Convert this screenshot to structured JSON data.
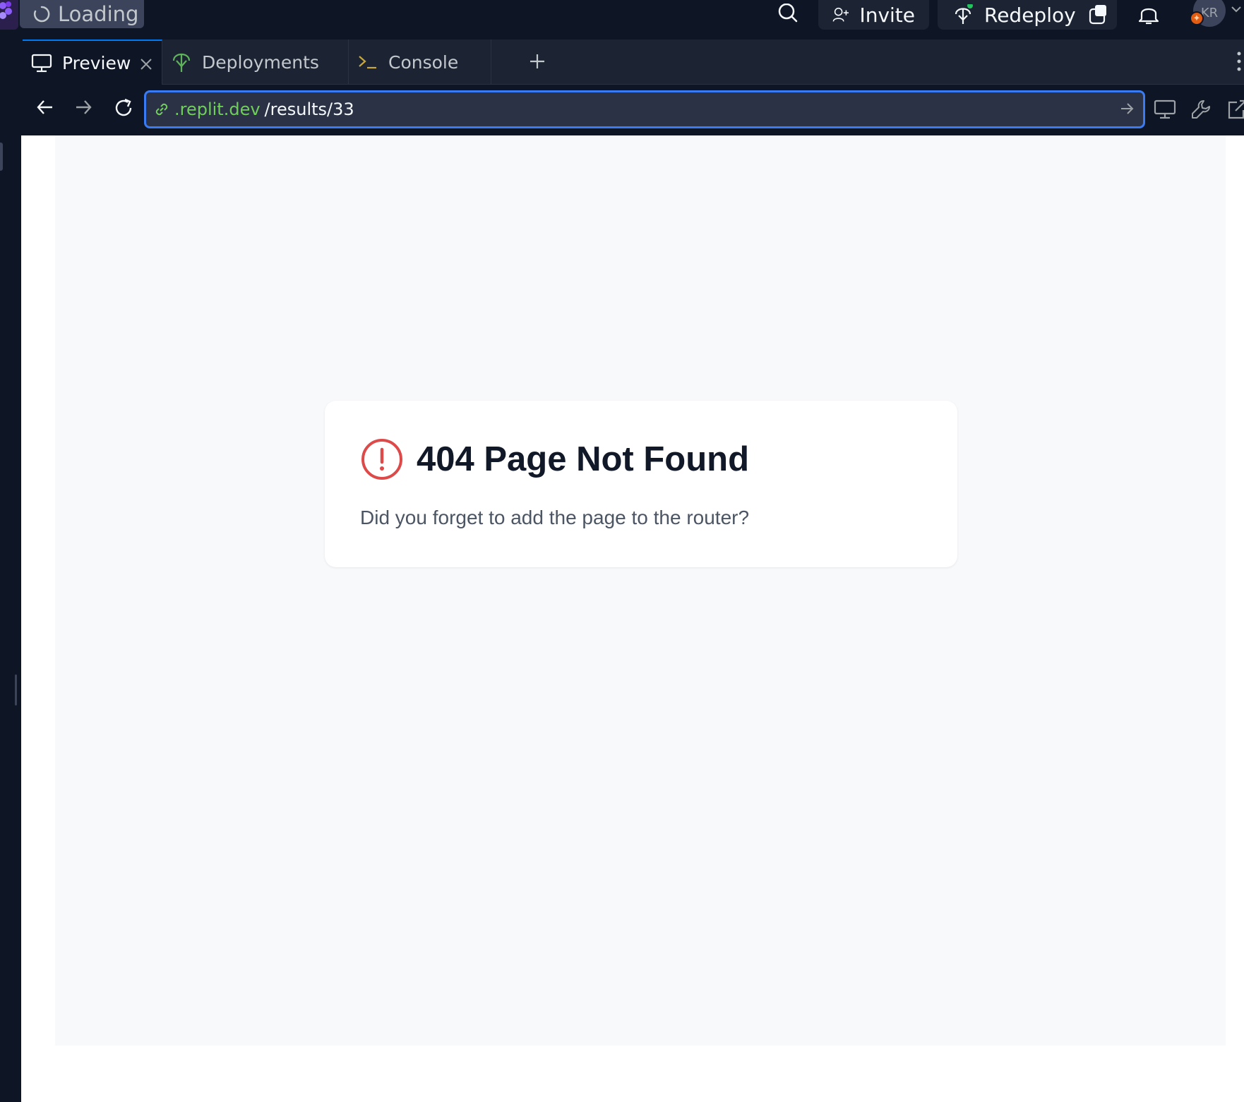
{
  "topbar": {
    "loading_label": "Loading",
    "invite_label": "Invite",
    "redeploy_label": "Redeploy",
    "avatar_initials": "KR",
    "avatar_badge": "✦"
  },
  "tabs": [
    {
      "label": "Preview",
      "icon": "monitor-icon",
      "active": true
    },
    {
      "label": "Deployments",
      "icon": "deploy-icon",
      "active": false
    },
    {
      "label": "Console",
      "icon": "terminal-icon",
      "active": false
    }
  ],
  "address": {
    "domain": ".replit.dev",
    "path": "/results/33"
  },
  "page": {
    "title": "404 Page Not Found",
    "message": "Did you forget to add the page to the router?"
  },
  "colors": {
    "accent": "#3a7af2",
    "url_domain": "#6fcf5a",
    "error": "#dc2626",
    "badge": "#e25c11"
  }
}
